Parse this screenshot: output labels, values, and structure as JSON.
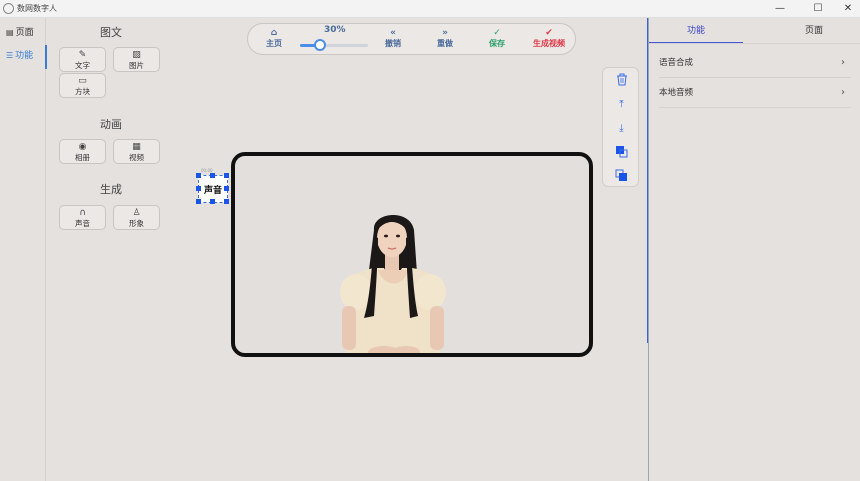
{
  "window": {
    "title": "数网数字人",
    "minimize": "—",
    "maximize": "☐",
    "close": "✕"
  },
  "leftnav": {
    "items": [
      {
        "icon": "▤",
        "label": "页面"
      },
      {
        "icon": "☰",
        "label": "功能"
      }
    ]
  },
  "palette": {
    "sections": [
      {
        "title": "图文",
        "tools": [
          {
            "icon": "✎",
            "label": "文字"
          },
          {
            "icon": "▨",
            "label": "图片"
          },
          {
            "icon": "▭",
            "label": "方块"
          }
        ]
      },
      {
        "title": "动画",
        "tools": [
          {
            "icon": "◉",
            "label": "相册"
          },
          {
            "icon": "▦",
            "label": "视频"
          }
        ]
      },
      {
        "title": "生成",
        "tools": [
          {
            "icon": "∩",
            "label": "声音"
          },
          {
            "icon": "♙",
            "label": "形象"
          }
        ]
      }
    ]
  },
  "toolbar": {
    "zoom": "30%",
    "zoom_fraction": 0.3,
    "home": {
      "icon": "⌂",
      "label": "主页"
    },
    "undo": {
      "icon": "«",
      "label": "撤销"
    },
    "redo": {
      "icon": "»",
      "label": "重做"
    },
    "save": {
      "icon": "✓",
      "label": "保存"
    },
    "generate": {
      "icon": "✔",
      "label": "生成视频"
    }
  },
  "canvas": {
    "sticker_text": "声音",
    "sticker_tag": "00:00"
  },
  "layer_tools": [
    {
      "icon": "🗑"
    },
    {
      "icon": "⤒"
    },
    {
      "icon": "⤓"
    },
    {
      "icon": "◩"
    },
    {
      "icon": "◪"
    }
  ],
  "rightpanel": {
    "tabs": [
      "功能",
      "页面"
    ],
    "items": [
      {
        "label": "语音合成",
        "chev": "›"
      },
      {
        "label": "本地音频",
        "chev": "›"
      }
    ]
  },
  "colors": {
    "accent": "#3a7bd5",
    "save": "#2ea06a",
    "generate": "#e03a4a",
    "primary_text": "#4a6a9a"
  }
}
